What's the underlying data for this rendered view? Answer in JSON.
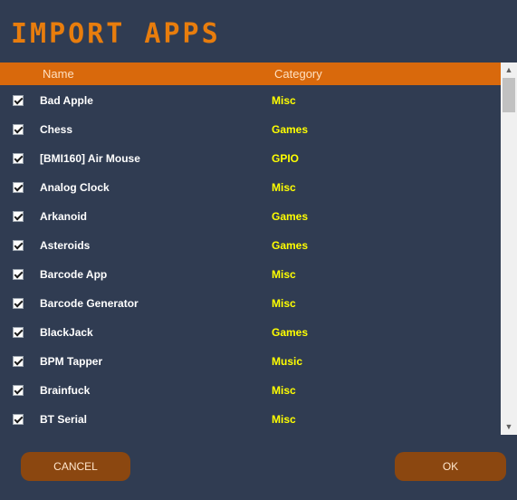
{
  "title": "IMPORT APPS",
  "columns": {
    "name": "Name",
    "category": "Category"
  },
  "apps": [
    {
      "name": "Bad Apple",
      "category": "Misc"
    },
    {
      "name": "Chess",
      "category": "Games"
    },
    {
      "name": "[BMI160] Air Mouse",
      "category": "GPIO"
    },
    {
      "name": "Analog Clock",
      "category": "Misc"
    },
    {
      "name": "Arkanoid",
      "category": "Games"
    },
    {
      "name": "Asteroids",
      "category": "Games"
    },
    {
      "name": "Barcode App",
      "category": "Misc"
    },
    {
      "name": "Barcode Generator",
      "category": "Misc"
    },
    {
      "name": "BlackJack",
      "category": "Games"
    },
    {
      "name": "BPM Tapper",
      "category": "Music"
    },
    {
      "name": "Brainfuck",
      "category": "Misc"
    },
    {
      "name": "BT Serial",
      "category": "Misc"
    }
  ],
  "buttons": {
    "cancel": "CANCEL",
    "ok": "OK"
  },
  "colors": {
    "accent": "#e87d0d",
    "header": "#d9690c",
    "background": "#303c52",
    "category": "#ffff00",
    "button": "#8b4710"
  },
  "icons": {
    "checkbox": "checkbox-checked-icon",
    "scroll_up": "chevron-up-icon",
    "scroll_down": "chevron-down-icon"
  }
}
